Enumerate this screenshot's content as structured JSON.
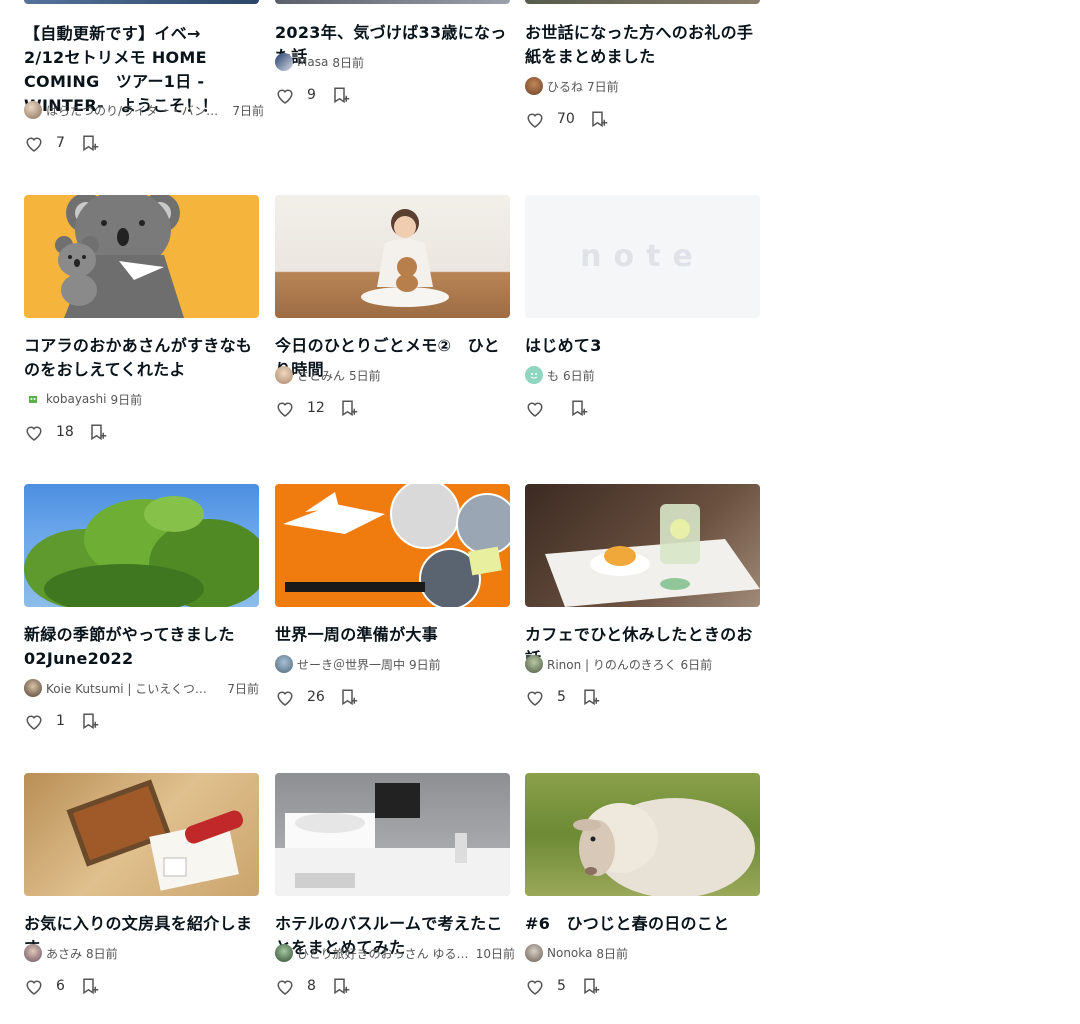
{
  "cards": [
    {
      "title": "【自動更新です】イベ→　2/12セトリメモ HOME COMING　ツアー1日 -WINTER-　ようこそ！！",
      "author": "はらたつのり/ライター・バンドマン・おいしいの人",
      "time": "7日前",
      "likes": "7"
    },
    {
      "title": "2023年、気づけば33歳になった話",
      "author": "Masa",
      "time": "8日前",
      "likes": "9"
    },
    {
      "title": "お世話になった方へのお礼の手紙をまとめました",
      "author": "ひるね",
      "time": "7日前",
      "likes": "70"
    },
    {
      "title": "コアラのおかあさんがすきなものをおしえてくれたよ",
      "author": "kobayashi",
      "time": "9日前",
      "likes": "18"
    },
    {
      "title": "今日のひとりごとメモ②　ひとり時間",
      "author": "さとみん",
      "time": "5日前",
      "likes": "12"
    },
    {
      "title": "はじめて3",
      "author": "も",
      "time": "6日前",
      "likes": ""
    },
    {
      "title": "新緑の季節がやってきました 02June2022",
      "author": "Koie Kutsumi | こいえくつみ（デザイナー・ライター）",
      "time": "7日前",
      "likes": "1"
    },
    {
      "title": "世界一周の準備が大事",
      "author": "せーき＠世界一周中",
      "time": "9日前",
      "likes": "26"
    },
    {
      "title": "カフェでひと休みしたときのお話",
      "author": "Rinon | りのんのきろく",
      "time": "6日前",
      "likes": "5"
    },
    {
      "title": "お気に入りの文房具を紹介します",
      "author": "あさみ",
      "time": "8日前",
      "likes": "6"
    },
    {
      "title": "ホテルのバスルームで考えたことをまとめてみた",
      "author": "ひとり旅好きのおっさん ゆるゆる旅",
      "time": "10日前",
      "likes": "8"
    },
    {
      "title": "#6　ひつじと春の日のこと",
      "author": "Nonoka",
      "time": "8日前",
      "likes": "5"
    }
  ],
  "logo_text": "note",
  "colors": {
    "accent": "#08131a",
    "text_muted": "#555555",
    "icon": "#555555"
  },
  "icons": {
    "like": "heart-icon",
    "magazine": "add-to-magazine-icon"
  }
}
